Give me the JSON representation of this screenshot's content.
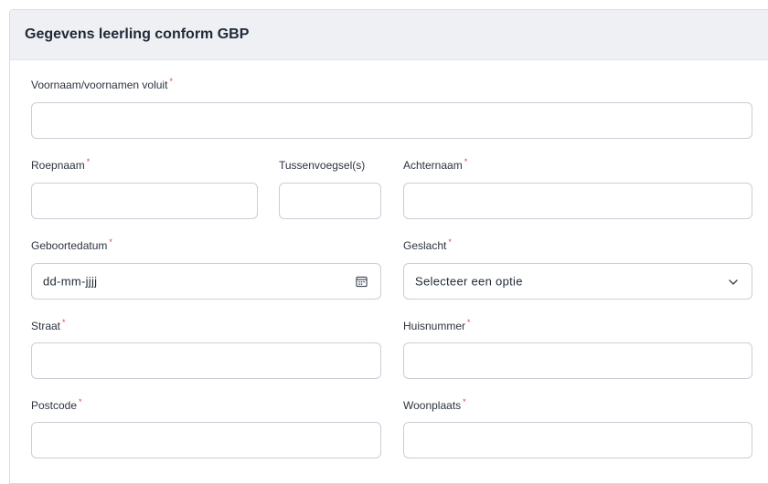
{
  "section": {
    "title": "Gegevens leerling conform GBP"
  },
  "fields": {
    "voornamen": {
      "label": "Voornaam/voornamen voluit",
      "required_mark": "*",
      "value": ""
    },
    "roepnaam": {
      "label": "Roepnaam",
      "required_mark": "*",
      "value": ""
    },
    "tussenvoegsel": {
      "label": "Tussenvoegsel(s)",
      "value": ""
    },
    "achternaam": {
      "label": "Achternaam",
      "required_mark": "*",
      "value": ""
    },
    "geboortedatum": {
      "label": "Geboortedatum",
      "required_mark": "*",
      "placeholder": "dd-mm-jjjj"
    },
    "geslacht": {
      "label": "Geslacht",
      "required_mark": "*",
      "selected": "Selecteer een optie"
    },
    "straat": {
      "label": "Straat",
      "required_mark": "*",
      "value": ""
    },
    "huisnummer": {
      "label": "Huisnummer",
      "required_mark": "*",
      "value": ""
    },
    "postcode": {
      "label": "Postcode",
      "required_mark": "*",
      "value": ""
    },
    "woonplaats": {
      "label": "Woonplaats",
      "required_mark": "*",
      "value": ""
    }
  },
  "icons": {
    "date": "calendar-icon",
    "select": "chevron-down-icon"
  },
  "colors": {
    "header_bg": "#eef0f4",
    "required": "#e04848",
    "border": "#c9ced6"
  }
}
